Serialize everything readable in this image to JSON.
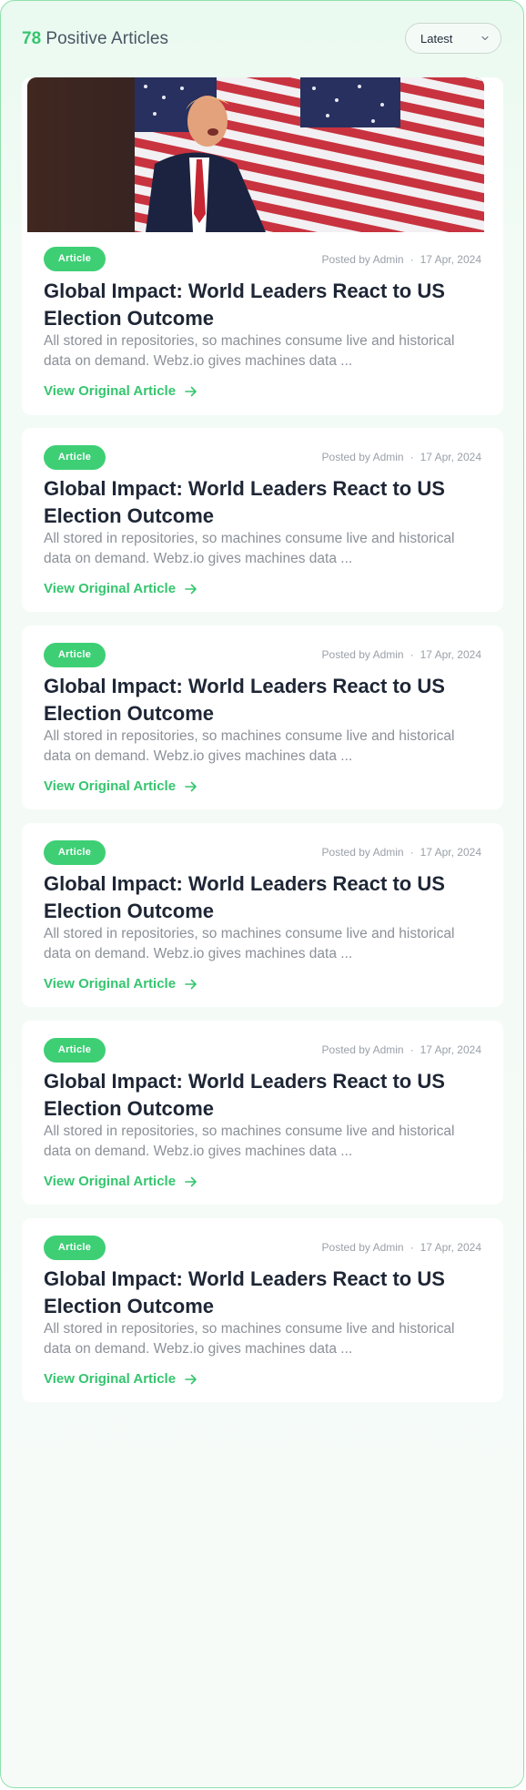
{
  "header": {
    "count": "78",
    "count_label": "Positive Articles",
    "sort_value": "Latest"
  },
  "colors": {
    "accent": "#36c56f",
    "badge": "#3ecf75",
    "title": "#1e2635",
    "muted": "#8b9098"
  },
  "icons": {
    "sort": "chevron-down-icon",
    "link": "arrow-right-icon"
  },
  "articles": [
    {
      "badge": "Article",
      "posted_by": "Posted by Admin",
      "date": "17 Apr, 2024",
      "title": "Global Impact: World Leaders React to US Election Outcome",
      "excerpt": "All stored in repositories, so machines consume live and historical data on demand. Webz.io gives machines data ...",
      "link": "View Original Article",
      "has_image": true
    },
    {
      "badge": "Article",
      "posted_by": "Posted by Admin",
      "date": "17 Apr, 2024",
      "title": "Global Impact: World Leaders React to US Election Outcome",
      "excerpt": "All stored in repositories, so machines consume live and historical data on demand. Webz.io gives machines data ...",
      "link": "View Original Article",
      "has_image": false
    },
    {
      "badge": "Article",
      "posted_by": "Posted by Admin",
      "date": "17 Apr, 2024",
      "title": "Global Impact: World Leaders React to US Election Outcome",
      "excerpt": "All stored in repositories, so machines consume live and historical data on demand. Webz.io gives machines data ...",
      "link": "View Original Article",
      "has_image": false
    },
    {
      "badge": "Article",
      "posted_by": "Posted by Admin",
      "date": "17 Apr, 2024",
      "title": "Global Impact: World Leaders React to US Election Outcome",
      "excerpt": "All stored in repositories, so machines consume live and historical data on demand. Webz.io gives machines data ...",
      "link": "View Original Article",
      "has_image": false
    },
    {
      "badge": "Article",
      "posted_by": "Posted by Admin",
      "date": "17 Apr, 2024",
      "title": "Global Impact: World Leaders React to US Election Outcome",
      "excerpt": "All stored in repositories, so machines consume live and historical data on demand. Webz.io gives machines data ...",
      "link": "View Original Article",
      "has_image": false
    },
    {
      "badge": "Article",
      "posted_by": "Posted by Admin",
      "date": "17 Apr, 2024",
      "title": "Global Impact: World Leaders React to US Election Outcome",
      "excerpt": "All stored in repositories, so machines consume live and historical data on demand. Webz.io gives machines data ...",
      "link": "View Original Article",
      "has_image": false
    }
  ]
}
